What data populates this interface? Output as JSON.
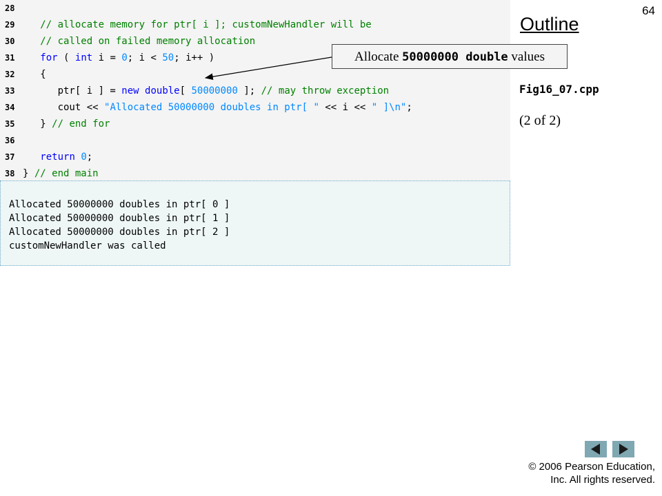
{
  "page_number": "64",
  "outline_title": "Outline",
  "callout": {
    "prefix": "Allocate ",
    "code_number": "50000000",
    "code_type": " double",
    "suffix": " values"
  },
  "file_name": "Fig16_07.cpp",
  "part_label": "(2 of 2)",
  "code_lines": [
    {
      "num": "28",
      "tokens": []
    },
    {
      "num": "29",
      "tokens": [
        {
          "t": "   ",
          "c": "plain"
        },
        {
          "t": "// allocate memory for ptr[ i ]; customNewHandler will be",
          "c": "cm"
        }
      ]
    },
    {
      "num": "30",
      "tokens": [
        {
          "t": "   ",
          "c": "plain"
        },
        {
          "t": "// called on failed memory allocation",
          "c": "cm"
        }
      ]
    },
    {
      "num": "31",
      "tokens": [
        {
          "t": "   ",
          "c": "plain"
        },
        {
          "t": "for",
          "c": "kw"
        },
        {
          "t": " ( ",
          "c": "plain"
        },
        {
          "t": "int",
          "c": "kw"
        },
        {
          "t": " i = ",
          "c": "plain"
        },
        {
          "t": "0",
          "c": "num"
        },
        {
          "t": "; i < ",
          "c": "plain"
        },
        {
          "t": "50",
          "c": "num"
        },
        {
          "t": "; i++ )",
          "c": "plain"
        }
      ]
    },
    {
      "num": "32",
      "tokens": [
        {
          "t": "   {",
          "c": "plain"
        }
      ]
    },
    {
      "num": "33",
      "tokens": [
        {
          "t": "      ptr[ i ] = ",
          "c": "plain"
        },
        {
          "t": "new",
          "c": "kw"
        },
        {
          "t": " ",
          "c": "plain"
        },
        {
          "t": "double",
          "c": "kw"
        },
        {
          "t": "[ ",
          "c": "plain"
        },
        {
          "t": "50000000",
          "c": "num"
        },
        {
          "t": " ]; ",
          "c": "plain"
        },
        {
          "t": "// may throw exception",
          "c": "cm"
        }
      ]
    },
    {
      "num": "34",
      "tokens": [
        {
          "t": "      cout << ",
          "c": "plain"
        },
        {
          "t": "\"Allocated 50000000 doubles in ptr[ \"",
          "c": "str"
        },
        {
          "t": " << i << ",
          "c": "plain"
        },
        {
          "t": "\" ]\\n\"",
          "c": "str"
        },
        {
          "t": ";",
          "c": "plain"
        }
      ]
    },
    {
      "num": "35",
      "tokens": [
        {
          "t": "   } ",
          "c": "plain"
        },
        {
          "t": "// end for",
          "c": "cm"
        }
      ]
    },
    {
      "num": "36",
      "tokens": []
    },
    {
      "num": "37",
      "tokens": [
        {
          "t": "   ",
          "c": "plain"
        },
        {
          "t": "return",
          "c": "kw"
        },
        {
          "t": " ",
          "c": "plain"
        },
        {
          "t": "0",
          "c": "num"
        },
        {
          "t": ";",
          "c": "plain"
        }
      ]
    },
    {
      "num": "38",
      "tokens": [
        {
          "t": "} ",
          "c": "plain"
        },
        {
          "t": "// end main",
          "c": "cm"
        }
      ]
    }
  ],
  "output_lines": [
    "Allocated 50000000 doubles in ptr[ 0 ]",
    "Allocated 50000000 doubles in ptr[ 1 ]",
    "Allocated 50000000 doubles in ptr[ 2 ]",
    "customNewHandler was called"
  ],
  "nav": {
    "prev_icon": "left-triangle-icon",
    "next_icon": "right-triangle-icon",
    "button_color": "#7fa8b2"
  },
  "copyright": {
    "line1": "© 2006 Pearson Education,",
    "line2": "Inc.  All rights reserved."
  },
  "colors": {
    "keyword": "#0000ff",
    "comment": "#008000",
    "literal": "#0088ff"
  }
}
